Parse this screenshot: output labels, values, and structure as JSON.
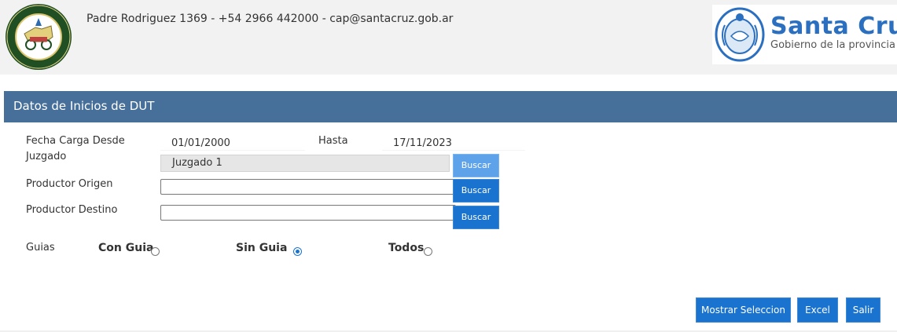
{
  "header": {
    "contact": "Padre Rodriguez 1369 - +54 2966 442000 - cap@santacruz.gob.ar",
    "left_logo_icon": "consejo-agrario-seal-icon",
    "right_logo": {
      "brand": "Santa Cruz",
      "subtitle": "Gobierno de la provincia",
      "icon": "santa-cruz-emblem-icon"
    }
  },
  "panel": {
    "title": "Datos de Inicios de DUT"
  },
  "form": {
    "fecha_desde": {
      "label": "Fecha Carga Desde",
      "value": "01/01/2000"
    },
    "hasta": {
      "label": "Hasta",
      "value": "17/11/2023"
    },
    "juzgado": {
      "label": "Juzgado",
      "value": "Juzgado 1",
      "button": "Buscar"
    },
    "productor_origen": {
      "label": "Productor Origen",
      "value": "",
      "button": "Buscar"
    },
    "productor_destino": {
      "label": "Productor Destino",
      "value": "",
      "button": "Buscar"
    },
    "guias": {
      "label": "Guias",
      "options": [
        {
          "label": "Con Guia",
          "checked": false
        },
        {
          "label": "Sin Guia",
          "checked": true
        },
        {
          "label": "Todos",
          "checked": false
        }
      ]
    }
  },
  "actions": {
    "mostrar": "Mostrar Seleccion",
    "excel": "Excel",
    "salir": "Salir"
  },
  "colors": {
    "panel_bar": "#466f9a",
    "button_blue": "#1a73cf",
    "brand_blue": "#2a6fc0"
  }
}
